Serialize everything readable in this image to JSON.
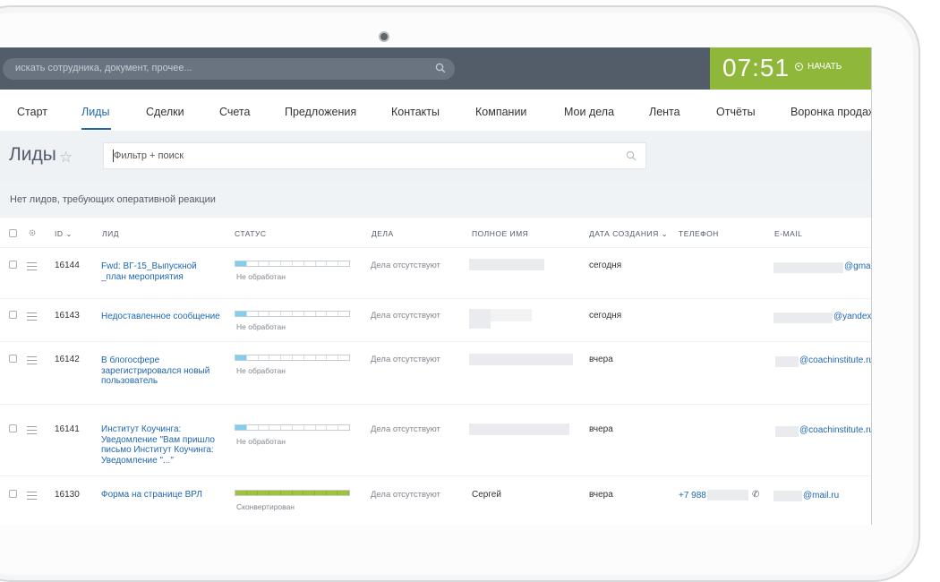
{
  "topbar": {
    "search_placeholder": "искать сотрудника, документ, прочее...",
    "clock": "07:51",
    "start_label": "НАЧАТЬ"
  },
  "nav": {
    "items": [
      "Старт",
      "Лиды",
      "Сделки",
      "Счета",
      "Предложения",
      "Контакты",
      "Компании",
      "Мои дела",
      "Лента",
      "Отчёты",
      "Воронка продаж"
    ],
    "active": "Лиды"
  },
  "page": {
    "title": "Лиды",
    "filter_placeholder": "Фильтр + поиск",
    "notice": "Нет лидов, требующих оперативной реакции"
  },
  "table": {
    "headers": {
      "id": "ID",
      "lead": "ЛИД",
      "status": "СТАТУС",
      "deals": "ДЕЛА",
      "fullname": "ПОЛНОЕ ИМЯ",
      "created": "ДАТА СОЗДАНИЯ",
      "phone": "ТЕЛЕФОН",
      "email": "E-MAIL"
    },
    "rows": [
      {
        "id": "16144",
        "lead": "Fwd: ВГ-15_Выпускной _план мероприятия",
        "status": "Не обработан",
        "deals": "Дела отсутствуют",
        "fullname": "",
        "created": "сегодня",
        "phone": "",
        "email": "@gmail.com"
      },
      {
        "id": "16143",
        "lead": "Недоставленное сообщение",
        "status": "Не обработан",
        "deals": "Дела отсутствуют",
        "fullname": "",
        "created": "сегодня",
        "phone": "",
        "email": "@yandex.ru"
      },
      {
        "id": "16142",
        "lead": "В блогосфере зарегистрировался новый пользователь",
        "status": "Не обработан",
        "deals": "Дела отсутствуют",
        "fullname": "",
        "created": "вчера",
        "phone": "",
        "email": "@coachinstitute.ru"
      },
      {
        "id": "16141",
        "lead": "Институт Коучинга: Уведомление \"Вам пришло письмо Институт Коучинга: Уведомление \"...\"",
        "status": "Не обработан",
        "deals": "Дела отсутствуют",
        "fullname": "",
        "created": "вчера",
        "phone": "",
        "email": "@coachinstitute.ru"
      },
      {
        "id": "16130",
        "lead": "Форма на странице ВРЛ",
        "status": "Сконвертирован",
        "deals": "Дела отсутствуют",
        "fullname": "Сергей",
        "created": "вчера",
        "phone": "+7 988",
        "email": "@mail.ru"
      }
    ]
  },
  "colors": {
    "topbar": "#535c69",
    "timer": "#8fb83b",
    "link": "#2067b0",
    "progress_new": "#7ecff0",
    "progress_done": "#9fc33b"
  }
}
